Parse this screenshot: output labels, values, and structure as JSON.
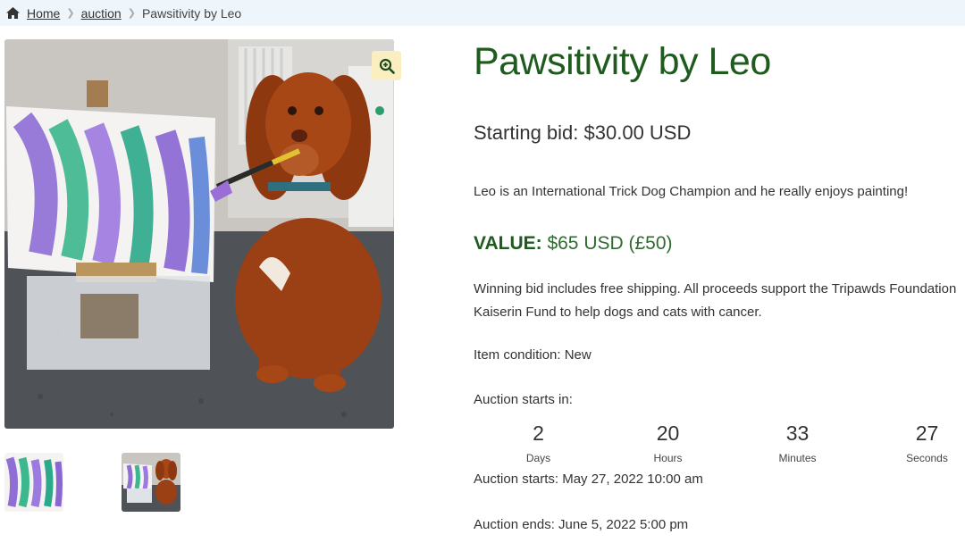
{
  "breadcrumb": {
    "home_icon": "home-icon",
    "home": "Home",
    "category": "auction",
    "current": "Pawsitivity by Leo"
  },
  "product": {
    "title": "Pawsitivity by Leo",
    "starting_bid": "Starting bid: $30.00 USD",
    "description": "Leo is an International Trick Dog Champion and he really enjoys painting!",
    "value_label": "VALUE:",
    "value_amount": " $65 USD (£50)",
    "shipping_text": "Winning bid includes free shipping. All proceeds support the Tripawds Foundation Kaiserin Fund to help dogs and cats with cancer.",
    "condition": "Item condition: New",
    "starts_in_label": "Auction starts in:",
    "auction_starts": "Auction starts: May 27, 2022 10:00 am",
    "auction_ends": "Auction ends: June 5, 2022 5:00 pm"
  },
  "countdown": [
    {
      "value": "2",
      "label": "Days"
    },
    {
      "value": "20",
      "label": "Hours"
    },
    {
      "value": "33",
      "label": "Minutes"
    },
    {
      "value": "27",
      "label": "Seconds"
    }
  ],
  "gallery": {
    "zoom_icon": "zoom-in-icon",
    "main_image": "dog-painting-photo",
    "thumbnails": [
      "painting-thumbnail",
      "dog-with-painting-thumbnail"
    ]
  },
  "colors": {
    "title_green": "#1f5a1f",
    "breadcrumb_bg": "#eef5fb",
    "zoom_bg": "#fbeec1"
  }
}
